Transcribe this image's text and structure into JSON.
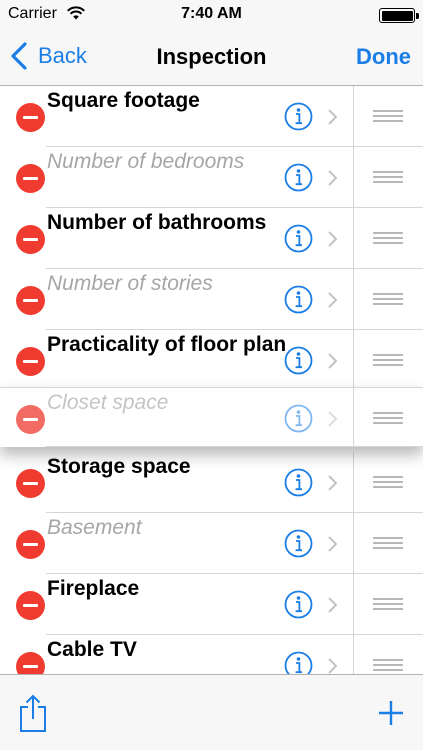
{
  "status_bar": {
    "carrier": "Carrier",
    "time": "7:40 AM",
    "wifi_icon": "wifi-icon",
    "battery_icon": "battery-icon",
    "battery_level": 1.0
  },
  "nav": {
    "back_label": "Back",
    "title": "Inspection",
    "done_label": "Done"
  },
  "rows": [
    {
      "label": "Square footage",
      "filled": true
    },
    {
      "label": "Number of bedrooms",
      "filled": false
    },
    {
      "label": "Number of bathrooms",
      "filled": true
    },
    {
      "label": "Number of stories",
      "filled": false
    },
    {
      "label": "Practicality of floor plan",
      "filled": true
    },
    {
      "label": "Storage space",
      "filled": true
    },
    {
      "label": "Basement",
      "filled": false
    },
    {
      "label": "Fireplace",
      "filled": true
    },
    {
      "label": "Cable TV",
      "filled": true
    }
  ],
  "dragging_row": {
    "label": "Closet space",
    "filled": false
  },
  "toolbar": {
    "share_icon": "share-icon",
    "add_icon": "plus-icon"
  },
  "colors": {
    "accent": "#1a7ee6",
    "delete": "#f03c30",
    "placeholder_text": "#a6a6a6",
    "separator": "#d6d6d6"
  }
}
